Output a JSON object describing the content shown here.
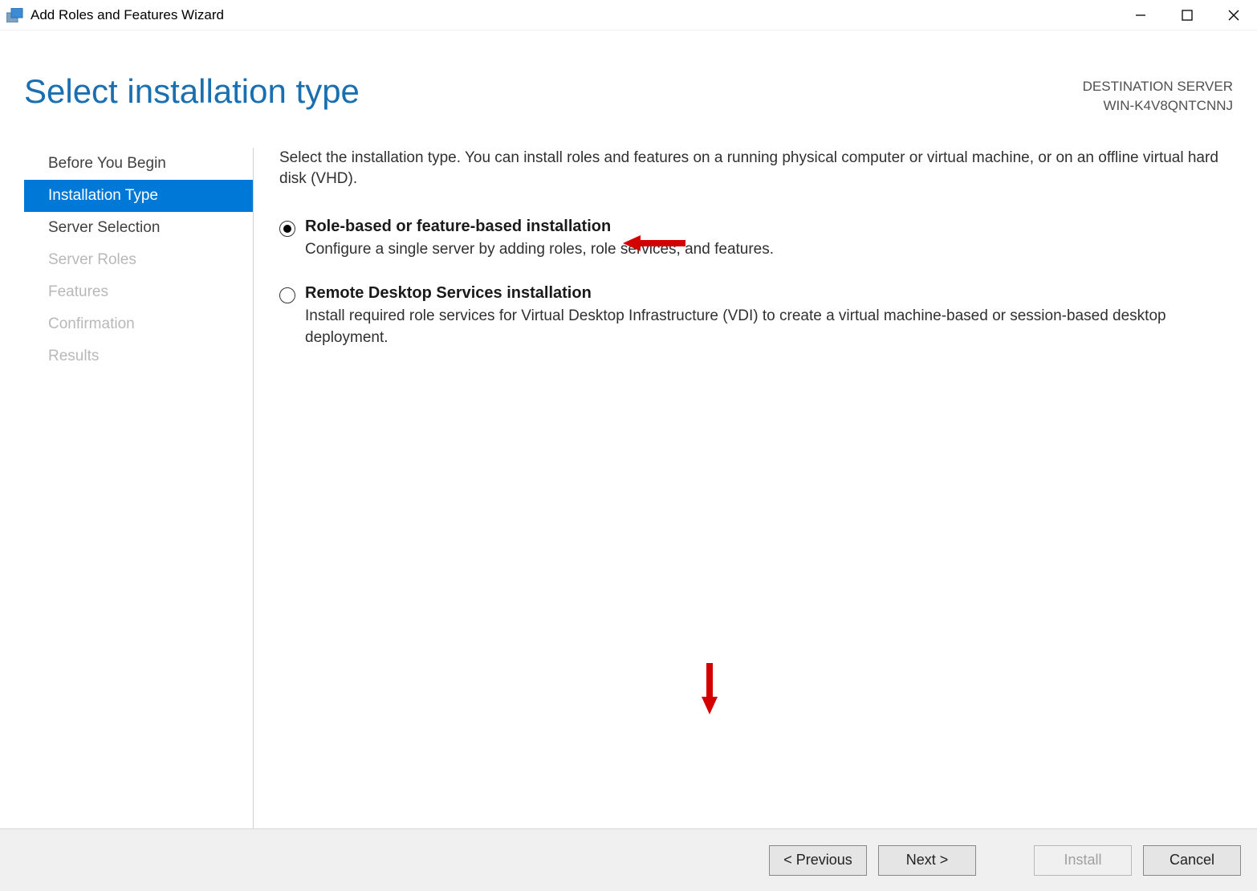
{
  "window": {
    "title": "Add Roles and Features Wizard"
  },
  "header": {
    "page_title": "Select installation type",
    "dest_label": "DESTINATION SERVER",
    "dest_value": "WIN-K4V8QNTCNNJ"
  },
  "sidebar": {
    "items": [
      {
        "label": "Before You Begin",
        "state": "enabled"
      },
      {
        "label": "Installation Type",
        "state": "selected"
      },
      {
        "label": "Server Selection",
        "state": "enabled"
      },
      {
        "label": "Server Roles",
        "state": "disabled"
      },
      {
        "label": "Features",
        "state": "disabled"
      },
      {
        "label": "Confirmation",
        "state": "disabled"
      },
      {
        "label": "Results",
        "state": "disabled"
      }
    ]
  },
  "content": {
    "intro": "Select the installation type. You can install roles and features on a running physical computer or virtual machine, or on an offline virtual hard disk (VHD).",
    "options": [
      {
        "title": "Role-based or feature-based installation",
        "desc": "Configure a single server by adding roles, role services, and features.",
        "checked": true
      },
      {
        "title": "Remote Desktop Services installation",
        "desc": "Install required role services for Virtual Desktop Infrastructure (VDI) to create a virtual machine-based or session-based desktop deployment.",
        "checked": false
      }
    ]
  },
  "footer": {
    "previous": "< Previous",
    "next": "Next >",
    "install": "Install",
    "cancel": "Cancel"
  }
}
